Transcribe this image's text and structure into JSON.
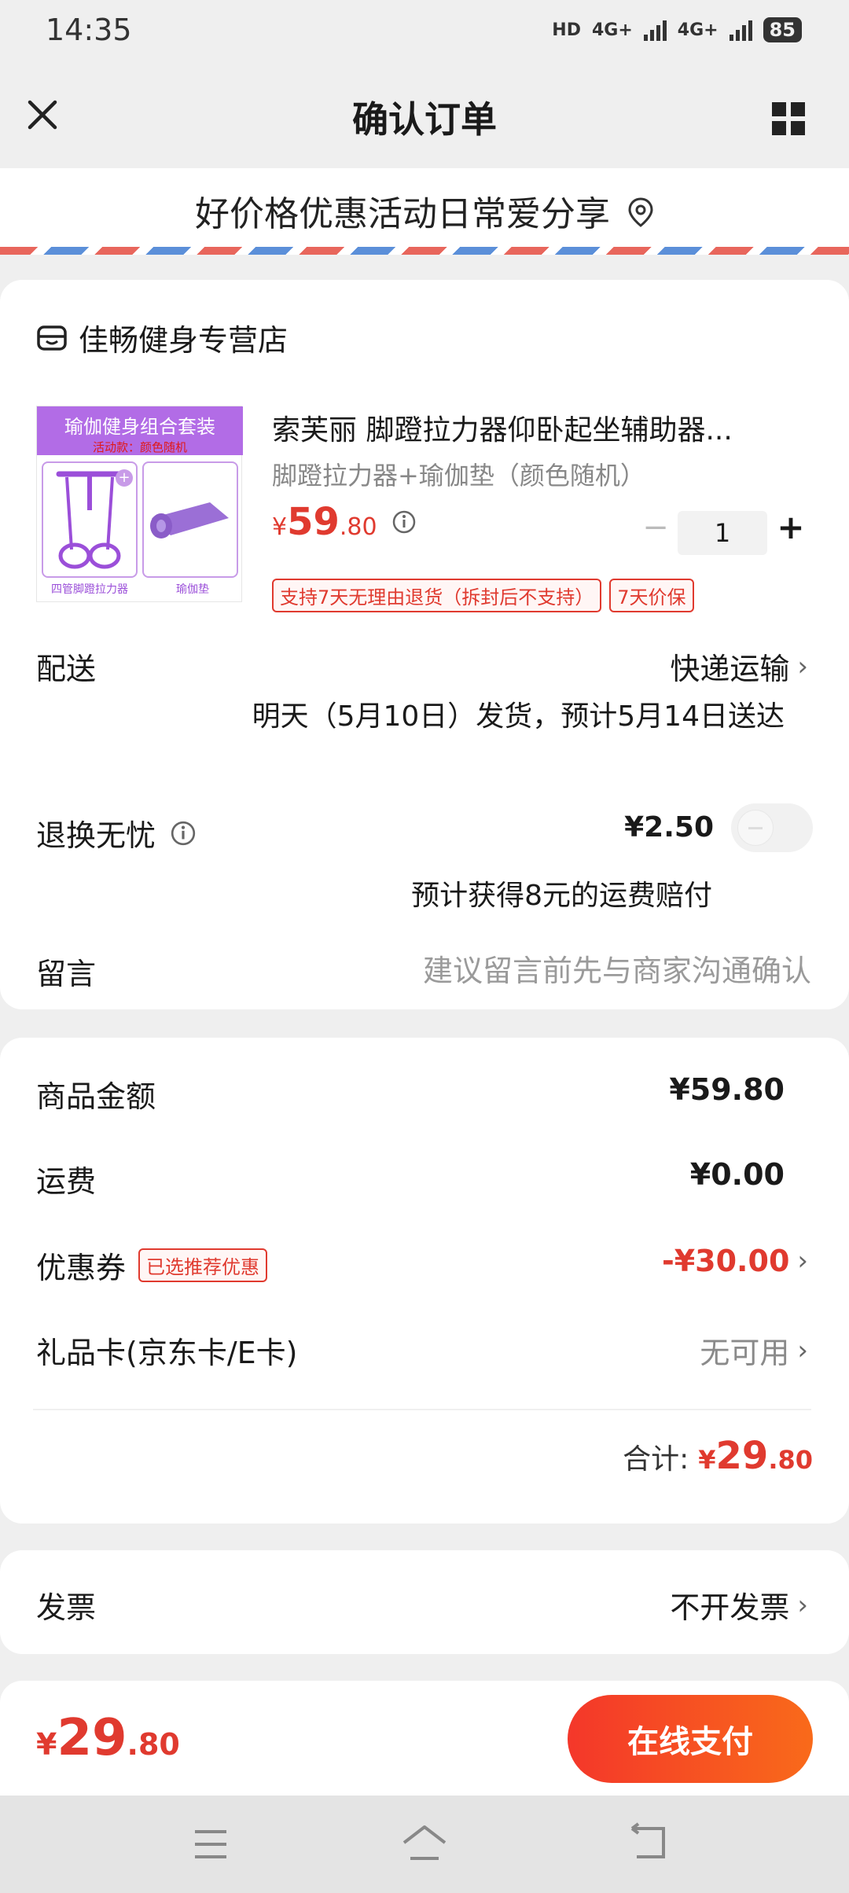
{
  "status": {
    "time": "14:35",
    "hd": "HD",
    "net1": "4G+",
    "net2": "4G+",
    "battery": "85"
  },
  "header": {
    "title": "确认订单"
  },
  "banner": {
    "text": "好价格优惠活动日常爱分享"
  },
  "store": {
    "name": "佳畅健身专营店"
  },
  "product": {
    "image_banner": "瑜伽健身组合套装",
    "image_sub": "活动款：颜色随机",
    "image_left_caption": "四管脚蹬拉力器",
    "image_right_caption": "瑜伽垫",
    "title": "索芙丽 脚蹬拉力器仰卧起坐辅助器...",
    "spec": "脚蹬拉力器+瑜伽垫（颜色随机）",
    "price_symbol": "¥",
    "price_int": "59",
    "price_dec": ".80",
    "quantity": "1",
    "minus": "−",
    "plus": "+",
    "tags": [
      "支持7天无理由退货（拆封后不支持）",
      "7天价保"
    ]
  },
  "delivery": {
    "label": "配送",
    "method": "快递运输",
    "info": "明天（5月10日）发货，预计5月14日送达"
  },
  "return_service": {
    "label": "退换无忧",
    "price": "¥2.50",
    "desc": "预计获得8元的运费赔付",
    "enabled": false
  },
  "message": {
    "label": "留言",
    "placeholder": "建议留言前先与商家沟通确认"
  },
  "summary": {
    "goods_label": "商品金额",
    "goods_value": "¥59.80",
    "shipping_label": "运费",
    "shipping_value": "¥0.00",
    "coupon_label": "优惠券",
    "coupon_tag": "已选推荐优惠",
    "coupon_value": "-¥30.00",
    "giftcard_label": "礼品卡(京东卡/E卡)",
    "giftcard_value": "无可用",
    "total_label": "合计:",
    "total_symbol": "¥",
    "total_int": "29",
    "total_dec": ".80"
  },
  "invoice": {
    "label": "发票",
    "value": "不开发票"
  },
  "paybar": {
    "symbol": "¥",
    "amount_int": "29",
    "amount_dec": ".80",
    "button": "在线支付"
  },
  "colors": {
    "accent": "#e03a2f",
    "pay_gradient_start": "#f4372a",
    "pay_gradient_end": "#f96a1a",
    "product_purple": "#9b4fd9"
  }
}
